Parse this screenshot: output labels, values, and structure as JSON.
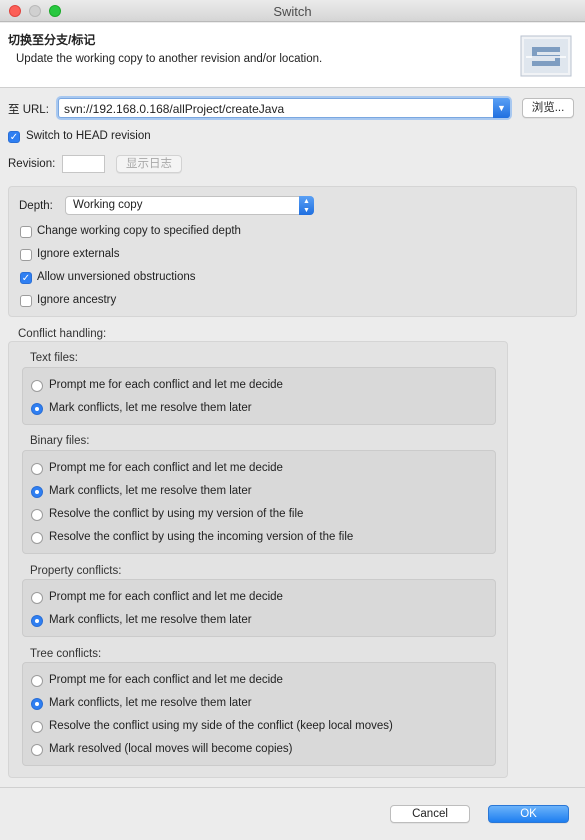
{
  "window": {
    "title": "Switch"
  },
  "header": {
    "title": "切换至分支/标记",
    "description": "Update the working copy to another revision and/or location.",
    "logo_icon": "subversion-logo-icon"
  },
  "url": {
    "label": "至 URL:",
    "value": "svn://192.168.0.168/allProject/createJava",
    "browse_label": "浏览..."
  },
  "switch_head": {
    "label": "Switch to HEAD revision",
    "checked": true
  },
  "revision": {
    "label": "Revision:",
    "value": "",
    "show_log_label": "显示日志"
  },
  "depth": {
    "label": "Depth:",
    "selected": "Working copy",
    "options": [
      {
        "label": "Change working copy to specified depth",
        "checked": false
      },
      {
        "label": "Ignore externals",
        "checked": false
      },
      {
        "label": "Allow unversioned obstructions",
        "checked": true
      },
      {
        "label": "Ignore ancestry",
        "checked": false
      }
    ]
  },
  "conflict": {
    "label": "Conflict handling:",
    "text_files": {
      "label": "Text files:",
      "options": [
        "Prompt me for each conflict and let me decide",
        "Mark conflicts, let me resolve them later"
      ],
      "selected_index": 1
    },
    "binary_files": {
      "label": "Binary files:",
      "options": [
        "Prompt me for each conflict and let me decide",
        "Mark conflicts, let me resolve them later",
        "Resolve the conflict by using my version of the file",
        "Resolve the conflict by using the incoming version of the file"
      ],
      "selected_index": 1
    },
    "property_conflicts": {
      "label": "Property conflicts:",
      "options": [
        "Prompt me for each conflict and let me decide",
        "Mark conflicts, let me resolve them later"
      ],
      "selected_index": 1
    },
    "tree_conflicts": {
      "label": "Tree conflicts:",
      "options": [
        "Prompt me for each conflict and let me decide",
        "Mark conflicts, let me resolve them later",
        "Resolve the conflict using my side of the conflict (keep local moves)",
        "Mark resolved (local moves will become copies)"
      ],
      "selected_index": 1
    }
  },
  "footer": {
    "cancel_label": "Cancel",
    "ok_label": "OK"
  },
  "colors": {
    "accent": "#2f7ff2",
    "panel": "#e3e3e3",
    "group": "#d9d9d9"
  }
}
